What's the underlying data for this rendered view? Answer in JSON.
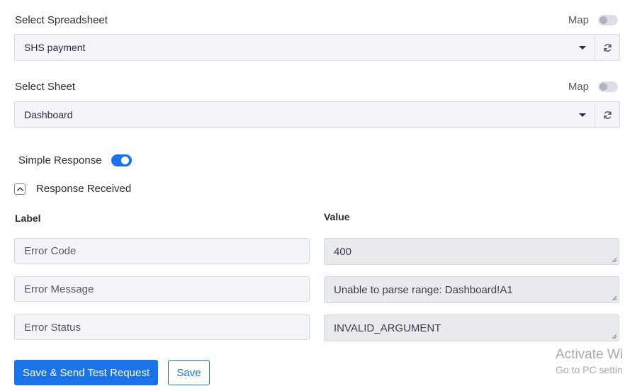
{
  "spreadsheet": {
    "label": "Select Spreadsheet",
    "map_label": "Map",
    "map_enabled": false,
    "selected": "SHS payment",
    "refresh_icon": "refresh-icon"
  },
  "sheet": {
    "label": "Select Sheet",
    "map_label": "Map",
    "map_enabled": false,
    "selected": "Dashboard",
    "refresh_icon": "refresh-icon"
  },
  "simple_response": {
    "label": "Simple Response",
    "enabled": true
  },
  "response_received": {
    "label": "Response Received",
    "expanded": true
  },
  "table": {
    "label_header": "Label",
    "value_header": "Value",
    "rows": [
      {
        "label": "Error Code",
        "value": "400"
      },
      {
        "label": "Error Message",
        "value": "Unable to parse range: Dashboard!A1"
      },
      {
        "label": "Error Status",
        "value": "INVALID_ARGUMENT"
      }
    ]
  },
  "actions": {
    "send_label": "Save & Send Test Request",
    "save_label": "Save"
  },
  "watermark": {
    "line1": "Activate Wi",
    "line2": "Go to PC settin"
  },
  "colors": {
    "accent": "#1a73e8",
    "field_bg": "#f3f5f8",
    "readonly_bg": "#e8eaed"
  }
}
